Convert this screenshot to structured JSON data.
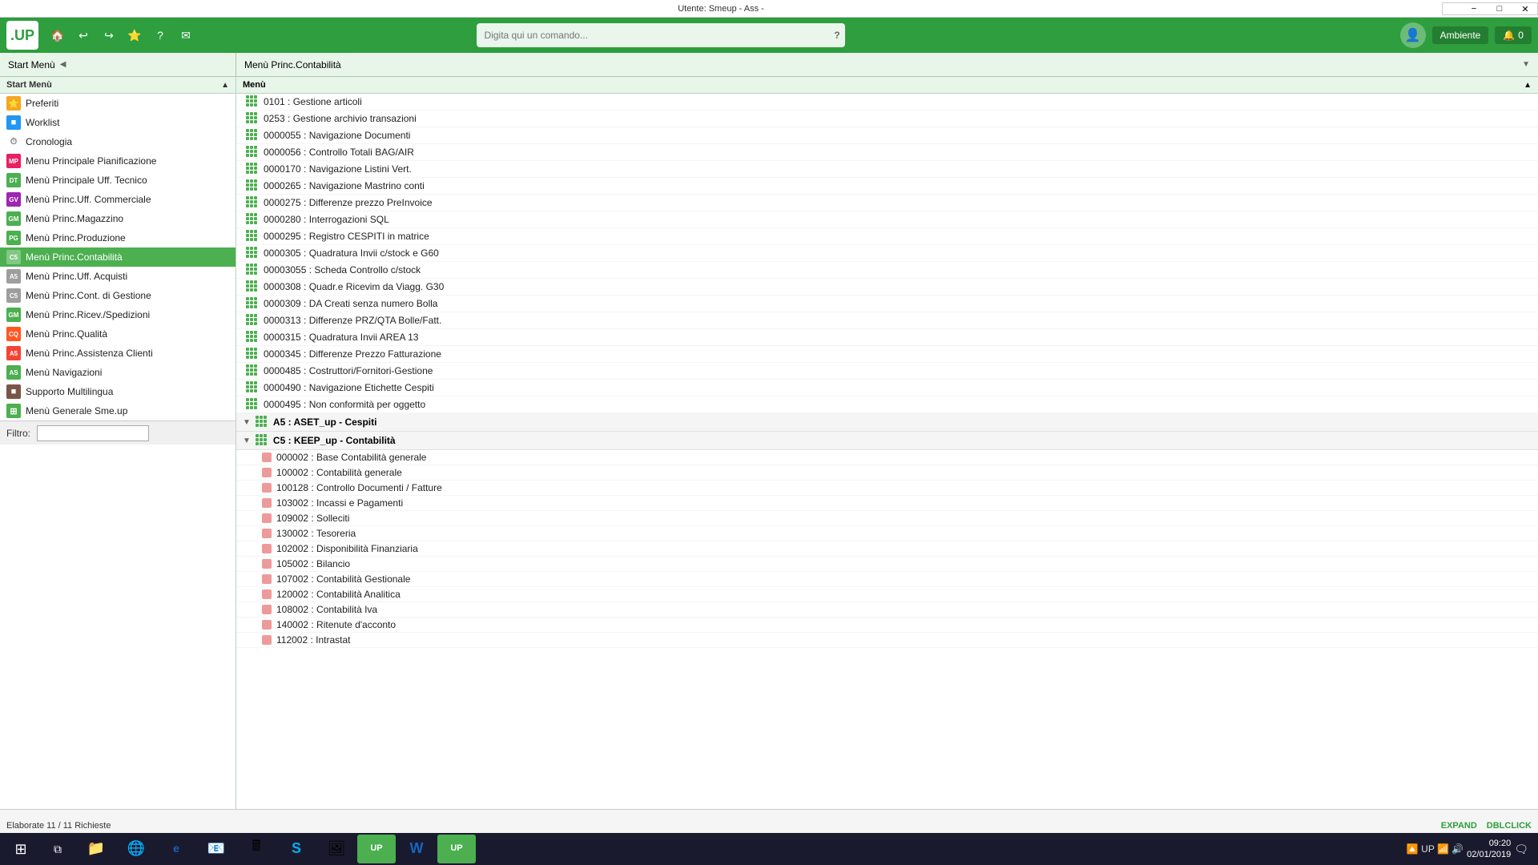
{
  "titleBar": {
    "text": "Utente: Smeup  -  Ass  -",
    "inputValue": ""
  },
  "toolbar": {
    "logo": ".UP",
    "searchPlaceholder": "Digita qui un comando...",
    "helpLabel": "?",
    "userLabel": "Ambiente",
    "notifCount": "0"
  },
  "panelHeaders": {
    "left": "Start Menù",
    "right": "Menù Princ.Contabilità"
  },
  "leftPanel": {
    "columnHeader": "Start Menù",
    "items": [
      {
        "label": "Preferiti",
        "icon": "⭐",
        "iconBg": "#f5a623",
        "iconColor": "#fff",
        "type": "star"
      },
      {
        "label": "Worklist",
        "icon": "■",
        "iconBg": "#2196F3",
        "iconColor": "#fff",
        "type": "square"
      },
      {
        "label": "Cronologia",
        "icon": "⏱",
        "iconBg": "#fff",
        "iconColor": "#888",
        "type": "clock"
      },
      {
        "label": "Menu Principale Pianificazione",
        "icon": "MP",
        "iconBg": "#e91e63",
        "iconColor": "#fff",
        "type": "text"
      },
      {
        "label": "Menù Principale Uff. Tecnico",
        "icon": "DT",
        "iconBg": "#4caf50",
        "iconColor": "#fff",
        "type": "text"
      },
      {
        "label": "Menù Princ.Uff. Commerciale",
        "icon": "GV",
        "iconBg": "#9c27b0",
        "iconColor": "#fff",
        "type": "text"
      },
      {
        "label": "Menù Princ.Magazzino",
        "icon": "GM",
        "iconBg": "#4caf50",
        "iconColor": "#fff",
        "type": "text"
      },
      {
        "label": "Menù Princ.Produzione",
        "icon": "PG",
        "iconBg": "#4caf50",
        "iconColor": "#fff",
        "type": "text"
      },
      {
        "label": "Menù Princ.Contabilità",
        "icon": "C5",
        "iconBg": "#ff9800",
        "iconColor": "#fff",
        "type": "text",
        "active": true
      },
      {
        "label": "Menù Princ.Uff. Acquisti",
        "icon": "A5",
        "iconBg": "#9e9e9e",
        "iconColor": "#fff",
        "type": "text"
      },
      {
        "label": "Menù Princ.Cont. di Gestione",
        "icon": "C5",
        "iconBg": "#9e9e9e",
        "iconColor": "#fff",
        "type": "text"
      },
      {
        "label": "Menù Princ.Ricev./Spedizioni",
        "icon": "GM",
        "iconBg": "#4caf50",
        "iconColor": "#fff",
        "type": "text"
      },
      {
        "label": "Menù Princ.Qualità",
        "icon": "CQ",
        "iconBg": "#ff5722",
        "iconColor": "#fff",
        "type": "text"
      },
      {
        "label": "Menù Princ.Assistenza Clienti",
        "icon": "A5",
        "iconBg": "#f44336",
        "iconColor": "#fff",
        "type": "text"
      },
      {
        "label": "Menù Navigazioni",
        "icon": "AS",
        "iconBg": "#4caf50",
        "iconColor": "#fff",
        "type": "text"
      },
      {
        "label": "Supporto Multilingua",
        "icon": "■",
        "iconBg": "#795548",
        "iconColor": "#fff",
        "type": "square"
      },
      {
        "label": "Menù Generale Sme.up",
        "icon": "⊞",
        "iconBg": "#4caf50",
        "iconColor": "#fff",
        "type": "grid"
      }
    ],
    "filterLabel": "Filtro:",
    "filterValue": ""
  },
  "rightPanel": {
    "columnHeader": "Menù",
    "items": [
      {
        "label": "0101 : Gestione articoli",
        "indent": 1
      },
      {
        "label": "0253 : Gestione archivio transazioni",
        "indent": 1
      },
      {
        "label": "0000055 : Navigazione Documenti",
        "indent": 1
      },
      {
        "label": "0000056 : Controllo Totali BAG/AIR",
        "indent": 1
      },
      {
        "label": "0000170 : Navigazione Listini Vert.",
        "indent": 1
      },
      {
        "label": "0000265 : Navigazione Mastrino conti",
        "indent": 1
      },
      {
        "label": "0000275 : Differenze prezzo PreInvoice",
        "indent": 1
      },
      {
        "label": "0000280 : Interrogazioni SQL",
        "indent": 1
      },
      {
        "label": "0000295 : Registro CESPITI in matrice",
        "indent": 1
      },
      {
        "label": "0000305 : Quadratura Invii c/stock e G60",
        "indent": 1
      },
      {
        "label": "00003055 : Scheda Controllo c/stock",
        "indent": 1
      },
      {
        "label": "0000308 : Quadr.e Ricevim da Viagg. G30",
        "indent": 1
      },
      {
        "label": "0000309 : DA Creati senza numero Bolla",
        "indent": 1
      },
      {
        "label": "0000313 : Differenze PRZ/QTA Bolle/Fatt.",
        "indent": 1
      },
      {
        "label": "0000315 : Quadratura Invii AREA 13",
        "indent": 1
      },
      {
        "label": "0000345 : Differenze Prezzo Fatturazione",
        "indent": 1
      },
      {
        "label": "0000485 : Costruttori/Fornitori-Gestione",
        "indent": 1
      },
      {
        "label": "0000490 : Navigazione Etichette Cespiti",
        "indent": 1
      },
      {
        "label": "0000495 : Non conformità per oggetto",
        "indent": 1
      },
      {
        "label": "A5 : ASET_up - Cespiti",
        "indent": 1,
        "isSection": true,
        "expanded": true
      },
      {
        "label": "C5 : KEEP_up - Contabilità",
        "indent": 1,
        "isSection": true,
        "expanded": true
      },
      {
        "label": "000002 : Base Contabilità generale",
        "indent": 2,
        "isSub": true
      },
      {
        "label": "100002 : Contabilità generale",
        "indent": 2,
        "isSub": true
      },
      {
        "label": "100128 : Controllo Documenti / Fatture",
        "indent": 2,
        "isSub": true
      },
      {
        "label": "103002 : Incassi e Pagamenti",
        "indent": 2,
        "isSub": true
      },
      {
        "label": "109002 : Solleciti",
        "indent": 2,
        "isSub": true
      },
      {
        "label": "130002 : Tesoreria",
        "indent": 2,
        "isSub": true
      },
      {
        "label": "102002 : Disponibilità Finanziaria",
        "indent": 2,
        "isSub": true
      },
      {
        "label": "105002 : Bilancio",
        "indent": 2,
        "isSub": true
      },
      {
        "label": "107002 : Contabilità Gestionale",
        "indent": 2,
        "isSub": true
      },
      {
        "label": "120002 : Contabilità Analitica",
        "indent": 2,
        "isSub": true
      },
      {
        "label": "108002 : Contabilità Iva",
        "indent": 2,
        "isSub": true
      },
      {
        "label": "140002 : Ritenute d'acconto",
        "indent": 2,
        "isSub": true
      },
      {
        "label": "112002 : Intrastat",
        "indent": 2,
        "isSub": true
      }
    ]
  },
  "statusBar": {
    "text": "Elaborate 11 / 11 Richieste",
    "expandLabel": "EXPAND",
    "dblclickLabel": "DBLCLICK"
  },
  "taskbar": {
    "time": "09:20",
    "date": "02/01/2019",
    "apps": [
      {
        "icon": "⊞",
        "label": "windows-start",
        "active": false
      },
      {
        "icon": "⧉",
        "label": "task-view",
        "active": false
      },
      {
        "icon": "📁",
        "label": "file-explorer",
        "active": false
      },
      {
        "icon": "🌐",
        "label": "edge-browser",
        "active": false
      },
      {
        "icon": "e",
        "label": "ie-browser",
        "active": false
      },
      {
        "icon": "📧",
        "label": "outlook",
        "active": false
      },
      {
        "icon": "🖩",
        "label": "calculator",
        "active": false
      },
      {
        "icon": "S",
        "label": "skype",
        "active": false
      },
      {
        "icon": "🖼",
        "label": "photos",
        "active": false
      },
      {
        "icon": "UP",
        "label": "smeup-1",
        "active": false
      },
      {
        "icon": "W",
        "label": "word",
        "active": false
      },
      {
        "icon": "UP",
        "label": "smeup-2",
        "active": true
      }
    ]
  }
}
